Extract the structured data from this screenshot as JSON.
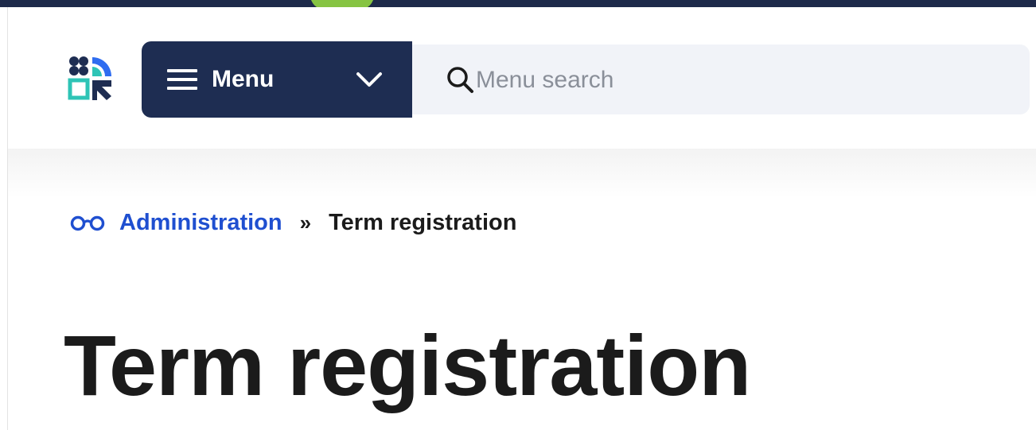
{
  "header": {
    "menu_label": "Menu",
    "search_placeholder": "Menu search",
    "icons": [
      "site-logo-icon",
      "hamburger-icon",
      "chevron-down-icon",
      "search-icon"
    ]
  },
  "breadcrumb": {
    "icon": "glasses-icon",
    "items": [
      {
        "label": "Administration"
      },
      {
        "label": "Term registration"
      }
    ],
    "separator": "»"
  },
  "page": {
    "title": "Term registration"
  },
  "colors": {
    "nav_dark": "#1e2d52",
    "link_blue": "#1f4fd0",
    "accent_green": "#86c442",
    "accent_teal": "#2ec4b6",
    "text_dark": "#1b1b1b",
    "search_bg": "#f1f3f8"
  }
}
